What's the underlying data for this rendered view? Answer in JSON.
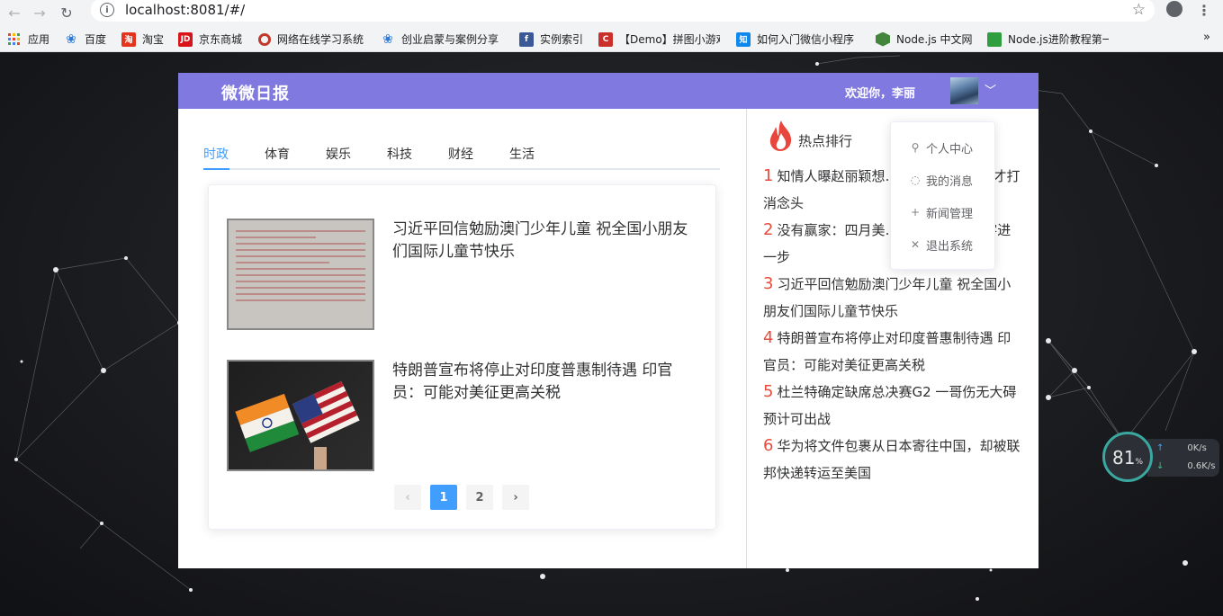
{
  "browser": {
    "url": "localhost:8081/#/",
    "bookmarks": [
      {
        "label": "应用",
        "icon": "apps-grid-icon",
        "color": "#4285f4"
      },
      {
        "label": "百度",
        "icon": "baidu-paw-icon",
        "color": "#2f7ad9"
      },
      {
        "label": "淘宝",
        "icon": "taobao-icon",
        "color": "#e5341d"
      },
      {
        "label": "京东商城",
        "icon": "jd-icon",
        "color": "#d8131a"
      },
      {
        "label": "网络在线学习系统",
        "icon": "circle-logo-icon",
        "color": "#c0392b"
      },
      {
        "label": "创业启蒙与案例分享",
        "icon": "baidu-paw-icon",
        "color": "#2f7ad9"
      },
      {
        "label": "实例索引",
        "icon": "facebook-icon",
        "color": "#3b5998"
      },
      {
        "label": "【Demo】拼图小游戏",
        "icon": "c-logo-icon",
        "color": "#c9302c"
      },
      {
        "label": "如何入门微信小程序",
        "icon": "zhihu-icon",
        "color": "#0f88eb"
      },
      {
        "label": "Node.js 中文网",
        "icon": "nodejs-hex-icon",
        "color": "#43853d"
      },
      {
        "label": "Node.js进阶教程第一",
        "icon": "book-icon",
        "color": "#2e9e3e"
      }
    ],
    "more": "»"
  },
  "app": {
    "title": "微微日报",
    "welcome": "欢迎你，李丽",
    "tabs": [
      "时政",
      "体育",
      "娱乐",
      "科技",
      "财经",
      "生活"
    ],
    "news": [
      {
        "title": "习近平回信勉励澳门少年儿童 祝全国小朋友们国际儿童节快乐",
        "thumb": "letter-image"
      },
      {
        "title": "特朗普宣布将停止对印度普惠制待遇 印官员：可能对美征更高关税",
        "thumb": "flags-image"
      }
    ],
    "pagination": {
      "prev": "‹",
      "pages": [
        "1",
        "2"
      ],
      "next": "›",
      "current": "1"
    },
    "hot": {
      "title": "热点排行",
      "items": [
        {
          "rank": "1",
          "text": "知情人曝赵丽颖想…人亲自上门安慰才打消念头"
        },
        {
          "rank": "2",
          "text": "没有赢家：四月美…双崩跌 贸易赤字进一步"
        },
        {
          "rank": "3",
          "text": "习近平回信勉励澳门少年儿童 祝全国小朋友们国际儿童节快乐"
        },
        {
          "rank": "4",
          "text": "特朗普宣布将停止对印度普惠制待遇 印官员：可能对美征更高关税"
        },
        {
          "rank": "5",
          "text": "杜兰特确定缺席总决赛G2 一哥伤无大碍预计可出战"
        },
        {
          "rank": "6",
          "text": "华为将文件包裹从日本寄往中国，却被联邦快递转运至美国"
        }
      ]
    },
    "dropdown": [
      {
        "label": "个人中心",
        "icon": "user-icon",
        "glyph": "⚲"
      },
      {
        "label": "我的消息",
        "icon": "message-icon",
        "glyph": "◌"
      },
      {
        "label": "新闻管理",
        "icon": "plus-icon",
        "glyph": "+"
      },
      {
        "label": "退出系统",
        "icon": "close-icon",
        "glyph": "✕"
      }
    ]
  },
  "widget": {
    "percent": "81",
    "pct_unit": "%",
    "up": "0K/s",
    "down": "0.6K/s"
  },
  "colors": {
    "header": "#8079e0",
    "accent": "#409eff",
    "rank": "#e74c3c"
  }
}
